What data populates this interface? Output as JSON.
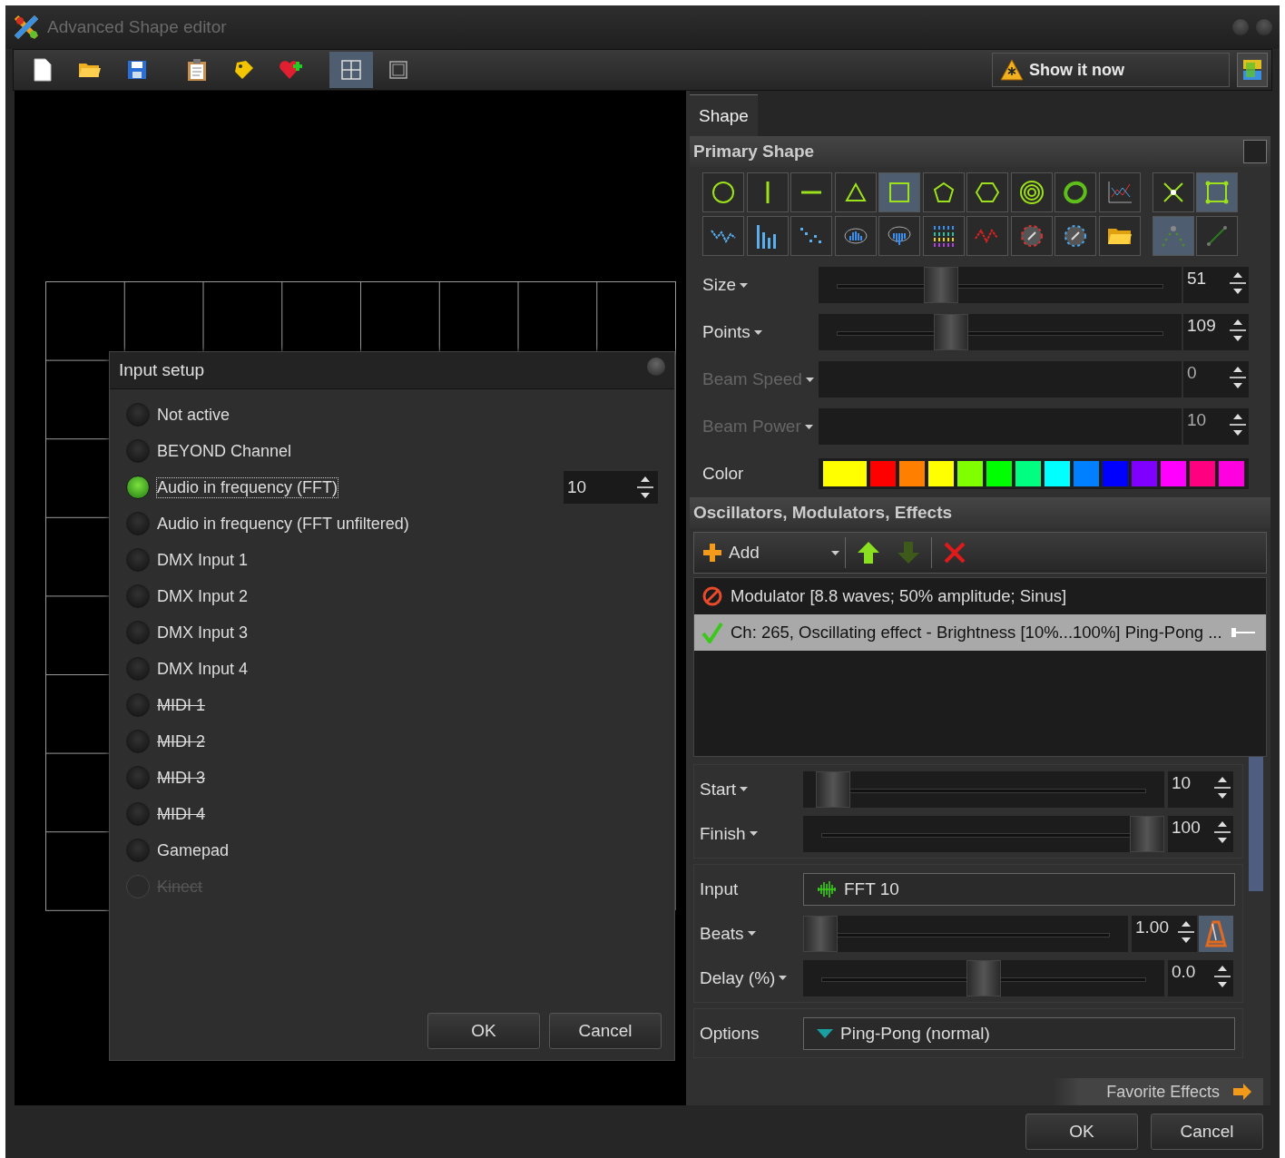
{
  "window": {
    "title": "Advanced Shape editor"
  },
  "toolbar": {
    "buttons": [
      {
        "kind": "new",
        "selected": false
      },
      {
        "kind": "open",
        "selected": false
      },
      {
        "kind": "save",
        "selected": false
      },
      {
        "kind": "clipboard",
        "selected": false
      },
      {
        "kind": "tag",
        "selected": false
      },
      {
        "kind": "heart",
        "selected": false
      },
      {
        "kind": "grid",
        "selected": true
      },
      {
        "kind": "frame",
        "selected": false
      }
    ],
    "show_button": "Show it now"
  },
  "input_setup": {
    "title": "Input setup",
    "options": [
      {
        "label": "Not active",
        "selected": false,
        "struck": false,
        "disabled": false
      },
      {
        "label": "BEYOND Channel",
        "selected": false,
        "struck": false,
        "disabled": false
      },
      {
        "label": "Audio in frequency (FFT)",
        "selected": true,
        "struck": false,
        "disabled": false,
        "value": "10"
      },
      {
        "label": "Audio in frequency (FFT unfiltered)",
        "selected": false,
        "struck": false,
        "disabled": false
      },
      {
        "label": "DMX Input 1",
        "selected": false,
        "struck": false,
        "disabled": false
      },
      {
        "label": "DMX Input 2",
        "selected": false,
        "struck": false,
        "disabled": false
      },
      {
        "label": "DMX Input 3",
        "selected": false,
        "struck": false,
        "disabled": false
      },
      {
        "label": "DMX Input 4",
        "selected": false,
        "struck": false,
        "disabled": false
      },
      {
        "label": "MIDI 1",
        "selected": false,
        "struck": true,
        "disabled": false
      },
      {
        "label": "MIDI 2",
        "selected": false,
        "struck": true,
        "disabled": false
      },
      {
        "label": "MIDI 3",
        "selected": false,
        "struck": true,
        "disabled": false
      },
      {
        "label": "MIDI 4",
        "selected": false,
        "struck": true,
        "disabled": false
      },
      {
        "label": "Gamepad",
        "selected": false,
        "struck": false,
        "disabled": false
      },
      {
        "label": "Kinect",
        "selected": false,
        "struck": true,
        "disabled": true
      }
    ],
    "buttons": [
      "OK",
      "Cancel"
    ]
  },
  "tabs": [
    {
      "label": "Shape",
      "selected": true
    }
  ],
  "primary_shape": {
    "title": "Primary Shape",
    "shapes": [
      {
        "kind": "circle",
        "selected": false
      },
      {
        "kind": "vline",
        "selected": false
      },
      {
        "kind": "hline",
        "selected": false
      },
      {
        "kind": "triangle",
        "selected": false
      },
      {
        "kind": "square",
        "selected": true
      },
      {
        "kind": "pentagon",
        "selected": false
      },
      {
        "kind": "hexagon",
        "selected": false
      },
      {
        "kind": "rings",
        "selected": false
      },
      {
        "kind": "swirl",
        "selected": false
      },
      {
        "kind": "chart",
        "selected": false
      },
      {
        "kind": "cross",
        "selected": false
      },
      {
        "kind": "bounds",
        "selected": true
      },
      {
        "kind": "wave",
        "selected": false
      },
      {
        "kind": "bars",
        "selected": false
      },
      {
        "kind": "dots",
        "selected": false
      },
      {
        "kind": "bowl",
        "selected": false
      },
      {
        "kind": "bowl2",
        "selected": false
      },
      {
        "kind": "colorgrid",
        "selected": false
      },
      {
        "kind": "zigzag",
        "selected": false
      },
      {
        "kind": "dialred",
        "selected": false
      },
      {
        "kind": "dialblue",
        "selected": false
      },
      {
        "kind": "folder",
        "selected": false
      },
      {
        "kind": "arc",
        "selected": true
      },
      {
        "kind": "diagonal",
        "selected": false
      }
    ],
    "params": [
      {
        "label": "Size",
        "disabled": false,
        "level": 0.32,
        "value": "51"
      },
      {
        "label": "Points",
        "disabled": false,
        "level": 0.35,
        "value": "109"
      },
      {
        "label": "Beam Speed",
        "disabled": true,
        "value": "0"
      },
      {
        "label": "Beam Power",
        "disabled": true,
        "value": "10"
      }
    ],
    "checked": false,
    "color_label": "Color",
    "palette": [
      {
        "color": "#ffff00",
        "selected": true
      },
      {
        "color": "#ff0000"
      },
      {
        "color": "#ff7f00"
      },
      {
        "color": "#ffff00"
      },
      {
        "color": "#80ff00"
      },
      {
        "color": "#00ff00"
      },
      {
        "color": "#00ff80"
      },
      {
        "color": "#00ffff"
      },
      {
        "color": "#0080ff"
      },
      {
        "color": "#0000ff"
      },
      {
        "color": "#8000ff"
      },
      {
        "color": "#ff00ff"
      },
      {
        "color": "#ff0080"
      },
      {
        "color": "#ff00e0"
      }
    ]
  },
  "effects": {
    "title": "Oscillators, Modulators, Effects",
    "add_label": "Add",
    "up_disabled": false,
    "down_disabled": true,
    "items": [
      {
        "label": "Modulator [8.8 waves; 50% amplitude; Sinus]",
        "enabled": false,
        "selected": false
      },
      {
        "label": "Ch: 265, Oscillating effect - Brightness [10%...100%] Ping-Pong ...",
        "enabled": true,
        "selected": true
      }
    ],
    "groups": [
      [
        {
          "kind": "slider",
          "label": "Start",
          "level": 0.04,
          "value": "10"
        },
        {
          "kind": "slider",
          "label": "Finish",
          "level": 1,
          "value": "100"
        }
      ],
      [
        {
          "kind": "source",
          "label": "Input",
          "value": "FFT 10"
        },
        {
          "kind": "slider-metronome",
          "label": "Beats",
          "level": 0,
          "value": "1.00"
        },
        {
          "kind": "slider",
          "label": "Delay (%)",
          "level": 0.5,
          "value": "0.0"
        }
      ],
      [
        {
          "kind": "dropdown",
          "label": "Options",
          "value": "Ping-Pong (normal)"
        }
      ]
    ],
    "favorites": "Favorite Effects"
  },
  "buttons": [
    "OK",
    "Cancel"
  ]
}
